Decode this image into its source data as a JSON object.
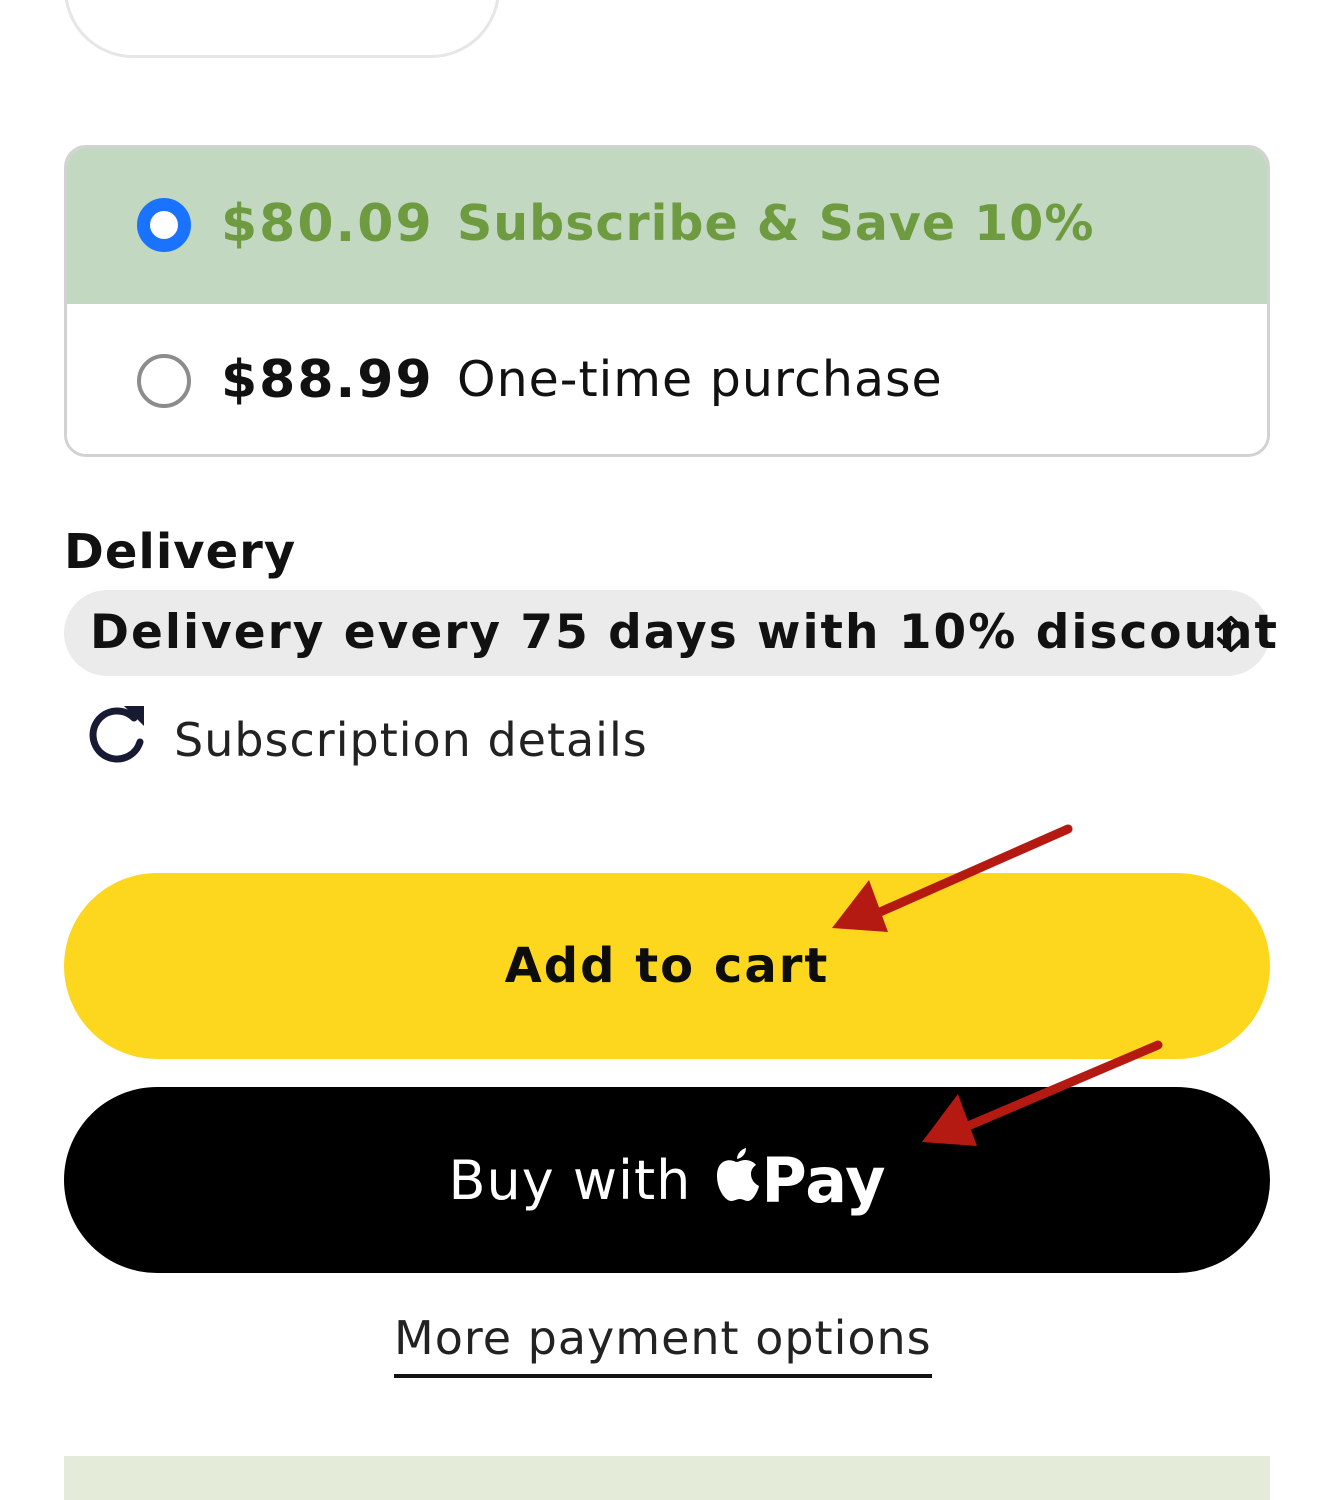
{
  "purchase_options": [
    {
      "price": "$80.09",
      "label": "Subscribe & Save 10%",
      "selected": true
    },
    {
      "price": "$88.99",
      "label": "One-time purchase",
      "selected": false
    }
  ],
  "delivery": {
    "label": "Delivery",
    "selected": "Delivery every 75 days with 10% discount",
    "chevron_icon": "chevron-up-down-icon"
  },
  "subscription_details": {
    "text": "Subscription details",
    "icon": "refresh-icon"
  },
  "buttons": {
    "add_to_cart": "Add to cart",
    "apple_pay_prefix": "Buy with",
    "apple_pay_suffix": "Pay"
  },
  "more_payment_options": "More payment options",
  "colors": {
    "subscribe_bg": "#c3d8c0",
    "subscribe_text": "#6e9b40",
    "radio_selected": "#1a73ff",
    "add_to_cart_bg": "#fdd71e",
    "apple_pay_bg": "#000000",
    "annotation_arrow": "#b51a12"
  }
}
